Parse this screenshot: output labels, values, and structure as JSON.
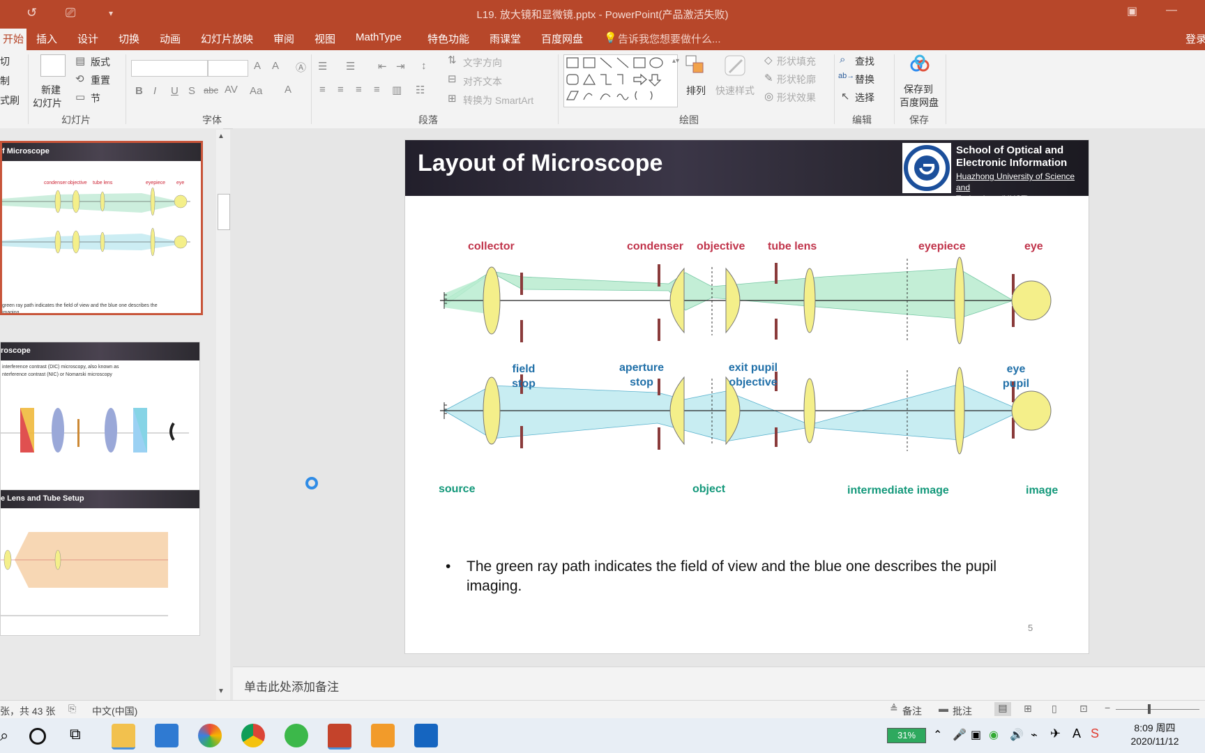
{
  "titlebar": {
    "title": "L19. 放大镜和显微镜.pptx - PowerPoint(产品激活失败)"
  },
  "tabs": [
    "开始",
    "插入",
    "设计",
    "切换",
    "动画",
    "幻灯片放映",
    "审阅",
    "视图",
    "MathType",
    "特色功能",
    "雨课堂",
    "百度网盘"
  ],
  "tell_me": "告诉我您想要做什么...",
  "login": "登录",
  "ribbon": {
    "clipboard": {
      "cut": "切",
      "copy": "制",
      "format_painter": "式刷"
    },
    "slides": {
      "new_slide_1": "新建",
      "new_slide_2": "幻灯片",
      "layout": "版式",
      "reset": "重置",
      "section": "节",
      "group": "幻灯片"
    },
    "font": {
      "group": "字体"
    },
    "paragraph": {
      "text_direction": "文字方向",
      "align_text": "对齐文本",
      "smartart": "转换为 SmartArt",
      "group": "段落"
    },
    "drawing": {
      "arrange": "排列",
      "quick_styles": "快速样式",
      "shape_fill": "形状填充",
      "shape_outline": "形状轮廓",
      "shape_effects": "形状效果",
      "group": "绘图"
    },
    "editing": {
      "find": "查找",
      "replace": "替换",
      "select": "选择",
      "group": "编辑"
    },
    "save": {
      "line1": "保存到",
      "line2": "百度网盘",
      "group": "保存"
    }
  },
  "thumbnails": [
    {
      "title": "f Microscope",
      "labels": [
        "condenser",
        "objective",
        "tube lens",
        "eyepiece",
        "eye"
      ],
      "caption": "green ray path indicates the field of view and the blue one describes the",
      "caption2": "imaging."
    },
    {
      "title": "roscope",
      "line1": "interference contrast (DIC) microscopy, also known as",
      "line2": "nterference contrast (NIC) or Nomarski microscopy"
    },
    {
      "title": "e Lens and Tube Setup"
    }
  ],
  "slide": {
    "title": "Layout of Microscope",
    "school_line1": "School of Optical and",
    "school_line2": "Electronic Information",
    "univ_line1": "Huazhong University of Science and",
    "univ_line2": "Technology (HUST)",
    "labels_top": {
      "collector": "collector",
      "condenser": "condenser",
      "objective": "objective",
      "tube_lens": "tube lens",
      "eyepiece": "eyepiece",
      "eye": "eye"
    },
    "labels_middle": {
      "field_stop_1": "field",
      "field_stop_2": "stop",
      "aperture_stop_1": "aperture",
      "aperture_stop_2": "stop",
      "exit_pupil_1": "exit pupil",
      "exit_pupil_2": "objective",
      "eye_pupil_1": "eye",
      "eye_pupil_2": "pupil"
    },
    "labels_bottom": {
      "source": "source",
      "object": "object",
      "intermediate_image": "intermediate image",
      "image": "image"
    },
    "bullet_symbol": "•",
    "bullet": "The green ray path indicates the field of view and the blue one describes the pupil imaging.",
    "page_number": "5"
  },
  "notes_placeholder": "单击此处添加备注",
  "status": {
    "slide_count": "张，共 43 张",
    "language": "中文(中国)",
    "notes": "备注",
    "comments": "批注"
  },
  "taskbar": {
    "battery": "31%",
    "time": "8:09 周四",
    "date": "2020/11/12"
  },
  "colors": {
    "accent": "#b7472a",
    "label_red": "#c0334a",
    "label_blue": "#1f6fa8",
    "label_green": "#13987a",
    "illumination_path": "#b9ecd0",
    "imaging_path": "#bfeaf0",
    "lens": "#f4ef8a"
  }
}
